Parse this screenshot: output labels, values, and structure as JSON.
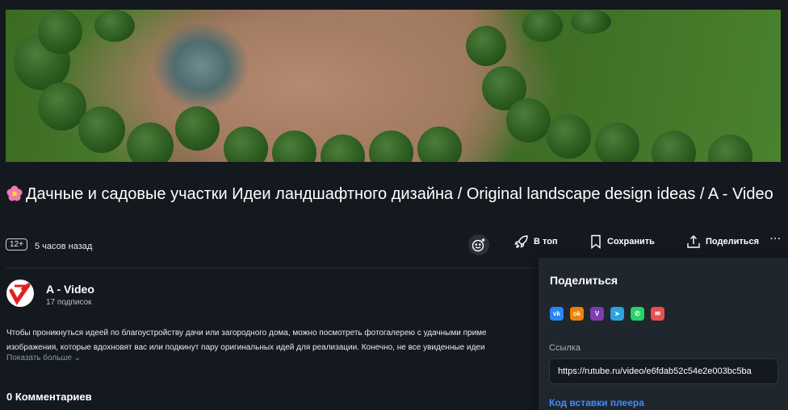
{
  "video": {
    "title": "Дачные и садовые участки Идеи ландшафтного дизайна / Original landscape design ideas / A - Video"
  },
  "meta": {
    "age": "12+",
    "time": "5 часов назад"
  },
  "actions": {
    "top": "В топ",
    "save": "Сохранить",
    "share": "Поделиться",
    "more": "···"
  },
  "channel": {
    "name": "A - Video",
    "subscribers": "17 подписок"
  },
  "description": {
    "line1": "Чтобы проникнуться идеей по благоустройству дачи или загородного дома, можно посмотреть фотогалерею с удачными приме",
    "line2": "изображения, которые вдохновят вас или подкинут пару оригинальных идей для реализации. Конечно, не все увиденные идеи",
    "show_more": "Показать больше"
  },
  "comments": {
    "heading": "0 Комментариев"
  },
  "share_panel": {
    "title": "Поделиться",
    "socials": [
      {
        "name": "vk",
        "label": "vk",
        "color": "#2787f5"
      },
      {
        "name": "odnoklassniki",
        "label": "ok",
        "color": "#ee8208"
      },
      {
        "name": "viber",
        "label": "V",
        "color": "#7d3daf"
      },
      {
        "name": "telegram",
        "label": "➤",
        "color": "#2aa3df"
      },
      {
        "name": "whatsapp",
        "label": "✆",
        "color": "#25d366"
      },
      {
        "name": "email",
        "label": "✉",
        "color": "#e94f4f"
      }
    ],
    "link_label": "Ссылка",
    "link": "https://rutube.ru/video/e6fdab52c54e2e003bc5ba",
    "embed": "Код вставки плеера"
  }
}
